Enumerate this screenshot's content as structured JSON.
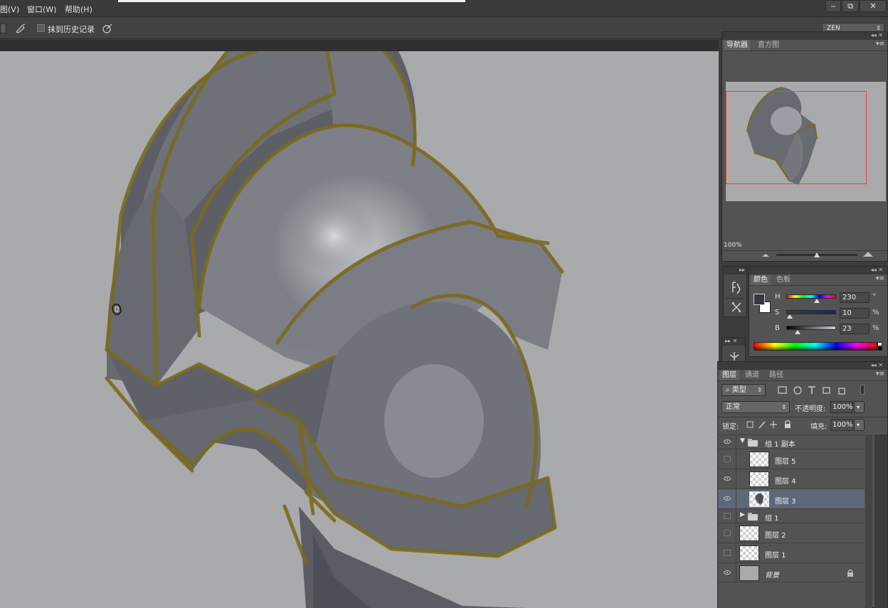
{
  "menu": {
    "view": "图(V)",
    "window": "窗口(W)",
    "help": "帮助(H)"
  },
  "window_controls": {
    "minimize": "‒",
    "restore": "⧉",
    "close": "✕"
  },
  "options": {
    "erase_history_label": "抹到历史记录",
    "workspace": "ZEN"
  },
  "navigator": {
    "tabs": [
      "导航器",
      "直方图"
    ],
    "zoom": "100%"
  },
  "color_panel": {
    "tabs": [
      "颜色",
      "色板"
    ],
    "rows": [
      {
        "letter": "H",
        "value": "230",
        "unit": "°"
      },
      {
        "letter": "S",
        "value": "10",
        "unit": "%"
      },
      {
        "letter": "B",
        "value": "23",
        "unit": "%"
      }
    ],
    "foreground_color": "#363a40",
    "background_color": "#ffffff"
  },
  "layers_panel": {
    "tabs": [
      "图层",
      "通道",
      "路径"
    ],
    "filter_kind": "类型",
    "blend_mode": "正常",
    "opacity_label": "不透明度:",
    "opacity_value": "100%",
    "lock_label": "锁定:",
    "fill_label": "填充:",
    "fill_value": "100%",
    "layers": [
      {
        "name": "组 1 副本",
        "type": "group",
        "expanded": true,
        "visible": true
      },
      {
        "name": "图层 5",
        "type": "layer",
        "visible": false
      },
      {
        "name": "图层 4",
        "type": "layer",
        "visible": true
      },
      {
        "name": "图层 3",
        "type": "layer",
        "visible": true,
        "selected": true
      },
      {
        "name": "组 1",
        "type": "group",
        "expanded": false,
        "visible": false
      },
      {
        "name": "图层 2",
        "type": "layer",
        "visible": false
      },
      {
        "name": "图层 1",
        "type": "layer",
        "visible": false
      },
      {
        "name": "背景",
        "type": "background",
        "visible": true,
        "locked": true
      }
    ]
  },
  "colors": {
    "canvas_bg": "#a9aaab",
    "outline": "#7a6a1c",
    "selection": "#5e6878"
  }
}
